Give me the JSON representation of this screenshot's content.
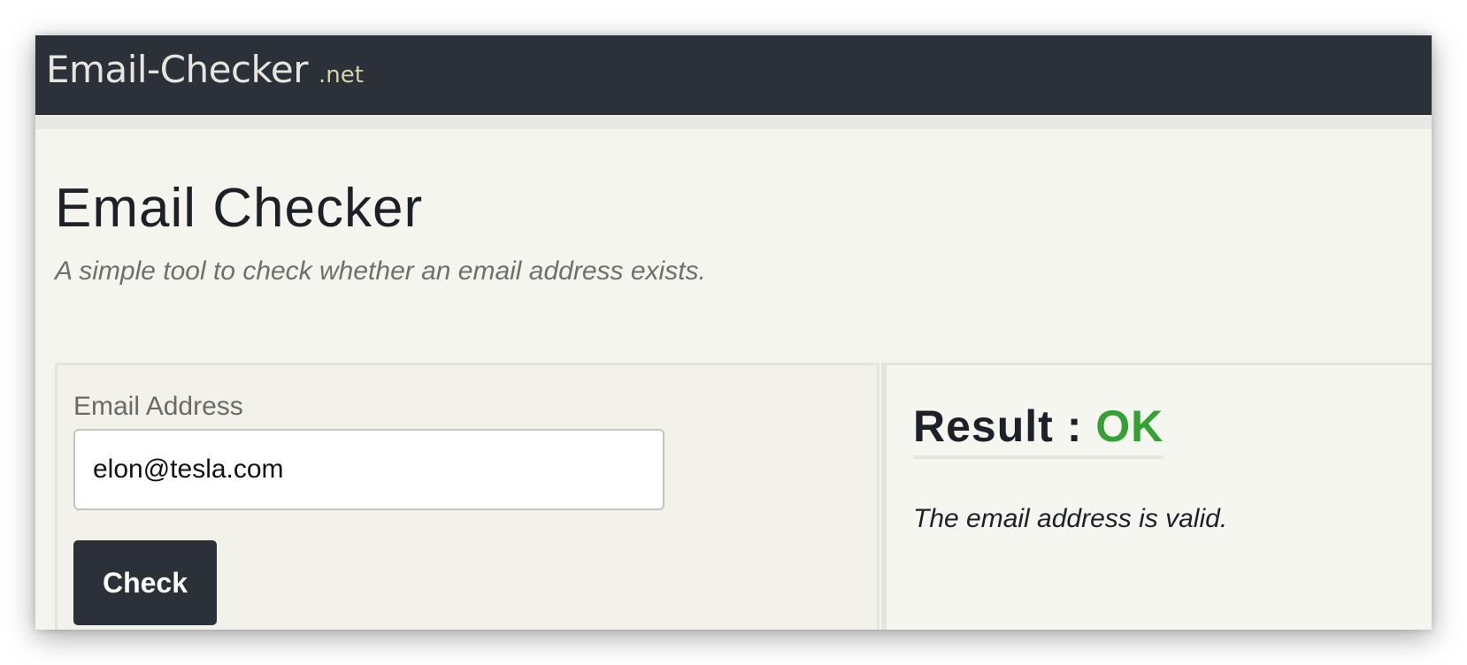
{
  "header": {
    "logo_main": "Email-Checker",
    "logo_tld": ".net"
  },
  "page": {
    "title": "Email Checker",
    "subtitle": "A simple tool to check whether an email address exists."
  },
  "form": {
    "email_label": "Email Address",
    "email_value": "elon@tesla.com",
    "check_label": "Check"
  },
  "result": {
    "label": "Result : ",
    "status": "OK",
    "status_color": "#35a135",
    "message": "The email address is valid."
  },
  "colors": {
    "navbar": "#2c3038",
    "background": "#f5f5ef",
    "text": "#1c2027"
  }
}
